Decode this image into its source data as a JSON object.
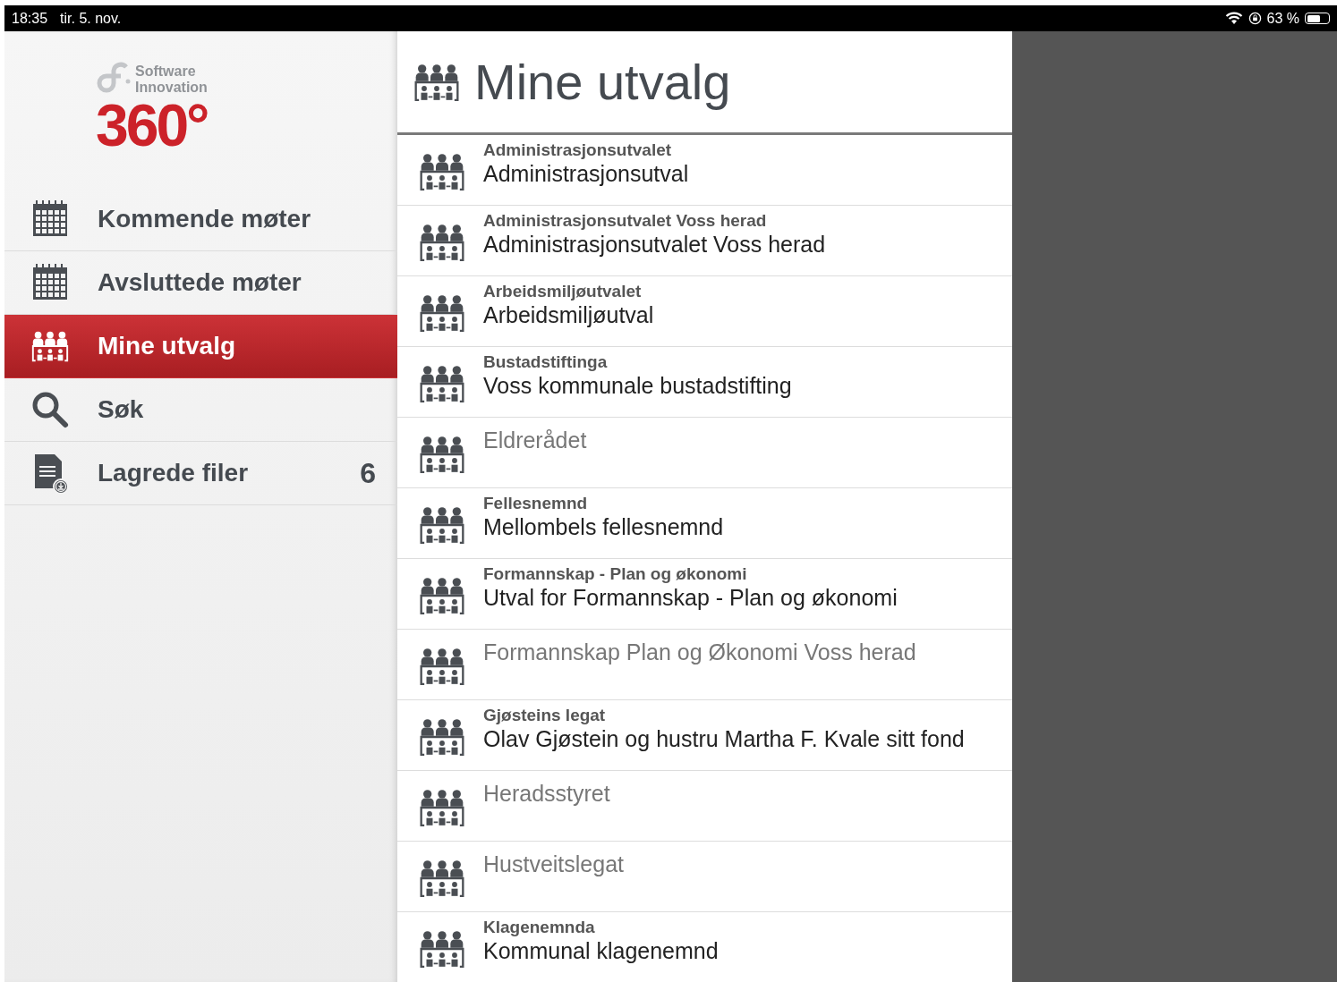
{
  "status_bar": {
    "time": "18:35",
    "date": "tir. 5. nov.",
    "battery_text": "63 %",
    "battery": {
      "level": 0.63
    }
  },
  "sidebar": {
    "logo": {
      "brand_line_1": "Software",
      "brand_line_2": "Innovation",
      "product": "360°"
    },
    "items": [
      {
        "kind": "calendar",
        "label": "Kommende møter",
        "selected": false
      },
      {
        "kind": "calendar",
        "label": "Avsluttede møter",
        "selected": false
      },
      {
        "kind": "committee",
        "label": "Mine utvalg",
        "selected": true
      },
      {
        "kind": "search",
        "label": "Søk",
        "selected": false
      },
      {
        "kind": "file",
        "label": "Lagrede filer",
        "selected": false,
        "count": "6"
      }
    ]
  },
  "main": {
    "title": "Mine utvalg",
    "items": [
      {
        "kind": "pair",
        "code": "Administrasjonsutvalet",
        "name": "Administrasjonsutval"
      },
      {
        "kind": "pair",
        "code": "Administrasjonsutvalet Voss herad",
        "name": "Administrasjonsutvalet Voss herad"
      },
      {
        "kind": "pair",
        "code": "Arbeidsmiljøutvalet",
        "name": "Arbeidsmiljøutval"
      },
      {
        "kind": "pair",
        "code": "Bustadstiftinga",
        "name": "Voss kommunale bustadstifting"
      },
      {
        "kind": "single",
        "name": "Eldrerådet"
      },
      {
        "kind": "pair",
        "code": "Fellesnemnd",
        "name": "Mellombels fellesnemnd"
      },
      {
        "kind": "pair",
        "code": "Formannskap - Plan og økonomi",
        "name": "Utval for Formannskap - Plan og økonomi"
      },
      {
        "kind": "single",
        "name": "Formannskap Plan og Økonomi Voss herad"
      },
      {
        "kind": "pair",
        "code": "Gjøsteins legat",
        "name": "Olav Gjøstein og hustru Martha F. Kvale sitt fond"
      },
      {
        "kind": "single",
        "name": "Heradsstyret"
      },
      {
        "kind": "single",
        "name": "Hustveitslegat"
      },
      {
        "kind": "pair",
        "code": "Klagenemnda",
        "name": "Kommunal klagenemnd"
      }
    ]
  }
}
